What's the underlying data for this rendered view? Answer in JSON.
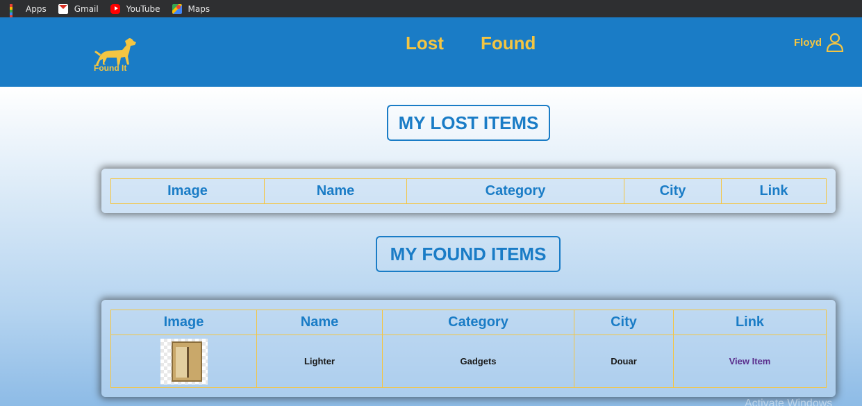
{
  "bookmarks": [
    {
      "label": "Apps",
      "icon": "apps-grid-icon"
    },
    {
      "label": "Gmail",
      "icon": "gmail-icon"
    },
    {
      "label": "YouTube",
      "icon": "youtube-icon"
    },
    {
      "label": "Maps",
      "icon": "maps-icon"
    }
  ],
  "header": {
    "logo_text": "Found It",
    "nav": {
      "lost": "Lost",
      "found": "Found"
    },
    "user_name": "Floyd"
  },
  "lost_section": {
    "title": "MY LOST ITEMS",
    "columns": [
      "Image",
      "Name",
      "Category",
      "City",
      "Link"
    ],
    "rows": []
  },
  "found_section": {
    "title": "MY FOUND ITEMS",
    "columns": [
      "Image",
      "Name",
      "Category",
      "City",
      "Link"
    ],
    "rows": [
      {
        "name": "Lighter",
        "category": "Gadgets",
        "city": "Douar",
        "link": "View Item"
      }
    ]
  },
  "watermark": "Activate Windows",
  "colors": {
    "header_bg": "#1a7cc6",
    "accent_yellow": "#f4c542",
    "title_blue": "#1a7cc6",
    "link_purple": "#5a2d8c"
  }
}
